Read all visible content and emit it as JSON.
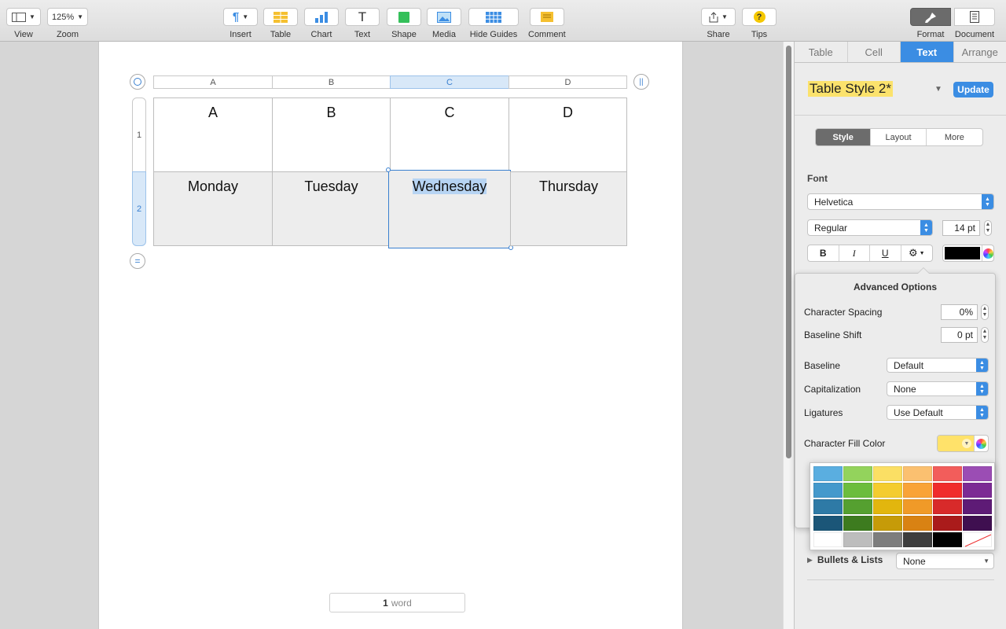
{
  "toolbar": {
    "view_label": "View",
    "zoom_value": "125%",
    "zoom_label": "Zoom",
    "insert_label": "Insert",
    "table_label": "Table",
    "chart_label": "Chart",
    "text_label": "Text",
    "shape_label": "Shape",
    "media_label": "Media",
    "hide_guides_label": "Hide Guides",
    "comment_label": "Comment",
    "share_label": "Share",
    "tips_label": "Tips",
    "format_label": "Format",
    "document_label": "Document"
  },
  "table": {
    "column_headers": [
      "A",
      "B",
      "C",
      "D"
    ],
    "row_headers": [
      "1",
      "2"
    ],
    "row1": [
      "A",
      "B",
      "C",
      "D"
    ],
    "row2": [
      "Monday",
      "Tuesday",
      "Wednesday",
      "Thursday"
    ]
  },
  "word_count": {
    "number": "1",
    "unit": "word"
  },
  "sidebar": {
    "tabs": [
      "Table",
      "Cell",
      "Text",
      "Arrange"
    ],
    "style_name": "Table Style 2*",
    "update_label": "Update",
    "segments": [
      "Style",
      "Layout",
      "More"
    ],
    "font_heading": "Font",
    "font_family": "Helvetica",
    "font_weight": "Regular",
    "font_size": "14 pt",
    "bold": "B",
    "italic": "I",
    "underline": "U",
    "bullets_label": "Bullets & Lists",
    "bullets_value": "None"
  },
  "advanced": {
    "title": "Advanced Options",
    "char_spacing_label": "Character Spacing",
    "char_spacing_value": "0%",
    "baseline_shift_label": "Baseline Shift",
    "baseline_shift_value": "0 pt",
    "baseline_label": "Baseline",
    "baseline_value": "Default",
    "capitalization_label": "Capitalization",
    "capitalization_value": "None",
    "ligatures_label": "Ligatures",
    "ligatures_value": "Use Default",
    "fill_color_label": "Character Fill Color",
    "fill_color": "#ffe26a"
  },
  "palette_colors": [
    [
      "#5aaee0",
      "#93d35c",
      "#fbdf64",
      "#fbc070",
      "#f25d5b",
      "#9b4db4"
    ],
    [
      "#4499cc",
      "#6cbd3d",
      "#f4cc2f",
      "#f9a337",
      "#f02c2c",
      "#7c2a94"
    ],
    [
      "#2e7aa6",
      "#55a030",
      "#e2b60e",
      "#f09a28",
      "#d82a2a",
      "#5e1b76"
    ],
    [
      "#1b5678",
      "#3d7b1f",
      "#c69b08",
      "#d98213",
      "#aa1b1b",
      "#3f0f50"
    ],
    [
      "#ffffff",
      "#bdbdbd",
      "#7d7d7d",
      "#3d3d3d",
      "#000000",
      "none"
    ]
  ]
}
